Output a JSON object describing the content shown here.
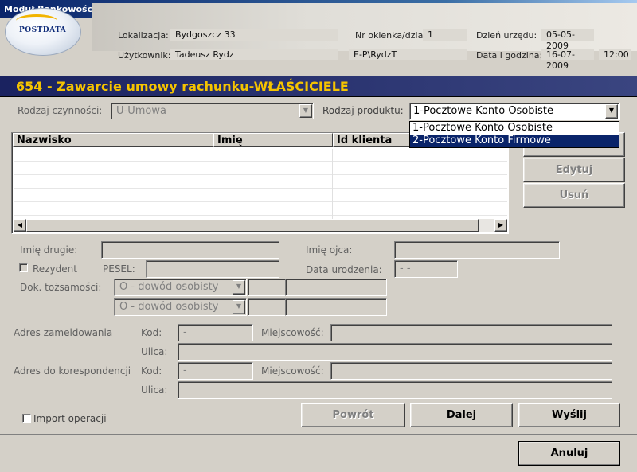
{
  "window": {
    "title": "Moduł Bankowości Pocztowej:"
  },
  "logo": {
    "text": "POSTDATA"
  },
  "header": {
    "lokalizacja_label": "Lokalizacja:",
    "lokalizacja_value": "Bydgoszcz 33",
    "okienko_label": "Nr okienka/dział:",
    "okienko_value": "1",
    "dzien_label": "Dzień urzędu:",
    "dzien_value": "05-05-2009",
    "uzytkownik_label": "Użytkownik:",
    "uzytkownik_value": "Tadeusz Rydz",
    "login_value": "E-P\\RydzT",
    "data_label": "Data i godzina:",
    "data_value": "16-07-2009",
    "godzina_value": "12:00"
  },
  "band": {
    "title": "654 - Zawarcie umowy rachunku-WŁAŚCICIELE"
  },
  "form": {
    "rodzaj_czynnosci_label": "Rodzaj czynności:",
    "rodzaj_czynnosci_value": "U-Umowa",
    "rodzaj_produktu_label": "Rodzaj produktu:",
    "rodzaj_produktu_value": "1-Pocztowe Konto Osobiste",
    "product_options": [
      "1-Pocztowe Konto Osobiste",
      "2-Pocztowe Konto Firmowe"
    ]
  },
  "table": {
    "columns": [
      "Nazwisko",
      "Imię",
      "Id klienta"
    ]
  },
  "side_buttons": {
    "edit": "Edytuj",
    "delete": "Usuń"
  },
  "person": {
    "imie_drugie_label": "Imię drugie:",
    "imie_ojca_label": "Imię ojca:",
    "rezydent_label": "Rezydent",
    "pesel_label": "PESEL:",
    "data_urodzenia_label": "Data urodzenia:",
    "data_urodzenia_value": "- -",
    "dok_label": "Dok. tożsamości:",
    "dok_value_1": "O - dowód osobisty",
    "dok_value_2": "O - dowód osobisty"
  },
  "address": {
    "zameldowania_label": "Adres zameldowania",
    "korespondencji_label": "Adres do korespondencji",
    "kod_label": "Kod:",
    "miejscowosc_label": "Miejscowość:",
    "ulica_label": "Ulica:",
    "kod_value": "-"
  },
  "footer": {
    "import_label": "Import operacji",
    "powrot": "Powrót",
    "dalej": "Dalej",
    "wyslij": "Wyślij",
    "anuluj": "Anuluj"
  }
}
